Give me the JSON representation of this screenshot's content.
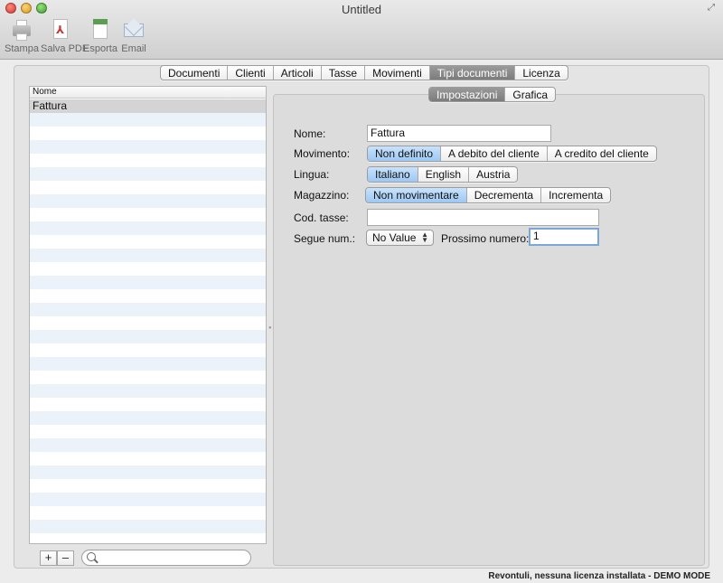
{
  "window": {
    "title": "Untitled"
  },
  "toolbar": [
    {
      "label": "Stampa",
      "icon": "printer-icon"
    },
    {
      "label": "Salva PDF",
      "icon": "pdf-icon"
    },
    {
      "label": "Esporta",
      "icon": "export-icon"
    },
    {
      "label": "Email",
      "icon": "email-icon"
    }
  ],
  "main_tabs": [
    "Documenti",
    "Clienti",
    "Articoli",
    "Tasse",
    "Movimenti",
    "Tipi documenti",
    "Licenza"
  ],
  "main_tab_selected": "Tipi documenti",
  "list": {
    "header": "Nome",
    "items": [
      "Fattura"
    ],
    "selected": "Fattura"
  },
  "list_controls": {
    "add": "+",
    "remove": "–"
  },
  "sub_tabs": [
    "Impostazioni",
    "Grafica"
  ],
  "sub_tab_selected": "Impostazioni",
  "form": {
    "nome_label": "Nome:",
    "nome_value": "Fattura",
    "movimento_label": "Movimento:",
    "movimento_options": [
      "Non definito",
      "A debito del cliente",
      "A credito del cliente"
    ],
    "movimento_selected": "Non definito",
    "lingua_label": "Lingua:",
    "lingua_options": [
      "Italiano",
      "English",
      "Austria"
    ],
    "lingua_selected": "Italiano",
    "magazzino_label": "Magazzino:",
    "magazzino_options": [
      "Non movimentare",
      "Decrementa",
      "Incrementa"
    ],
    "magazzino_selected": "Non movimentare",
    "cod_tasse_label": "Cod. tasse:",
    "cod_tasse_value": "",
    "segue_label": "Segue num.:",
    "segue_value": "No Value",
    "prossimo_label": "Prossimo numero:",
    "prossimo_value": "1"
  },
  "status_bar": "Revontuli, nessuna licenza installata - DEMO MODE"
}
